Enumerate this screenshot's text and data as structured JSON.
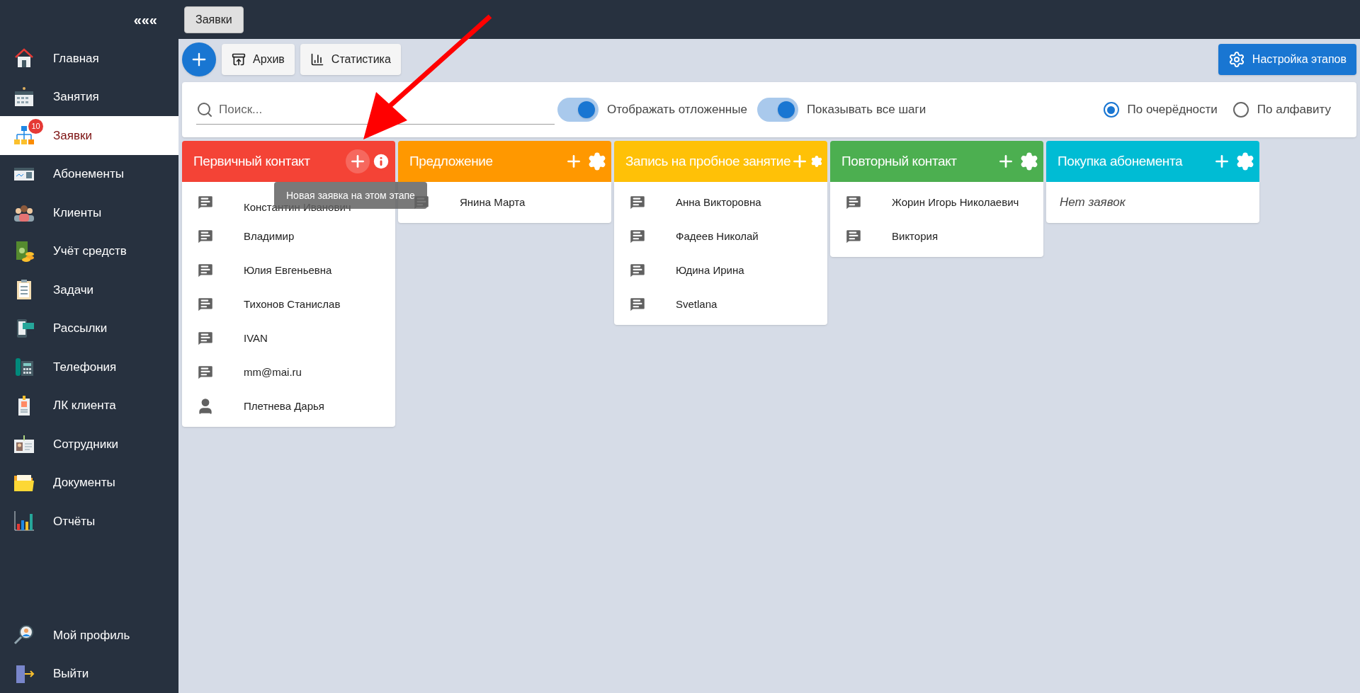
{
  "sidebar": {
    "collapse": "«««",
    "items": [
      {
        "label": "Главная",
        "selected": false
      },
      {
        "label": "Занятия",
        "selected": false
      },
      {
        "label": "Заявки",
        "selected": true,
        "badge": "10"
      },
      {
        "label": "Абонементы",
        "selected": false
      },
      {
        "label": "Клиенты",
        "selected": false
      },
      {
        "label": "Учёт средств",
        "selected": false
      },
      {
        "label": "Задачи",
        "selected": false
      },
      {
        "label": "Рассылки",
        "selected": false
      },
      {
        "label": "Телефония",
        "selected": false
      },
      {
        "label": "ЛК клиента",
        "selected": false
      },
      {
        "label": "Сотрудники",
        "selected": false
      },
      {
        "label": "Документы",
        "selected": false
      },
      {
        "label": "Отчёты",
        "selected": false
      }
    ],
    "bottom_items": [
      {
        "label": "Мой профиль"
      },
      {
        "label": "Выйти"
      }
    ]
  },
  "top_tab": "Заявки",
  "toolbar": {
    "archive": "Архив",
    "stats": "Статистика",
    "settings": "Настройка этапов"
  },
  "filters": {
    "search": {
      "placeholder": "Поиск..."
    },
    "toggles": [
      {
        "label": "Отображать отложенные",
        "on": true
      },
      {
        "label": "Показывать все шаги",
        "on": true
      }
    ],
    "sort": [
      {
        "label": "По очерёдности",
        "selected": true
      },
      {
        "label": "По алфавиту",
        "selected": false
      }
    ]
  },
  "columns": [
    {
      "title": "Первичный контакт",
      "color": "#f44336",
      "kind": "info",
      "add_hovered": true,
      "tooltip": "Новая заявка на этом этапе",
      "items": [
        {
          "name": "Константин Иванович",
          "kind": "message"
        },
        {
          "name": "Владимир",
          "kind": "message"
        },
        {
          "name": "Юлия Евгеньевна",
          "kind": "message"
        },
        {
          "name": "Тихонов Станислав",
          "kind": "message"
        },
        {
          "name": "IVAN",
          "kind": "message"
        },
        {
          "name": "mm@mai.ru",
          "kind": "message"
        },
        {
          "name": "Плетнева Дарья",
          "kind": "person"
        }
      ]
    },
    {
      "title": "Предложение",
      "color": "#ff9800",
      "kind": "settings",
      "add_hovered": false,
      "items": [
        {
          "name": "Янина Марта",
          "kind": "message"
        }
      ]
    },
    {
      "title": "Запись на пробное занятие",
      "color": "#ffc107",
      "kind": "settings",
      "add_hovered": false,
      "items": [
        {
          "name": "Анна Викторовна",
          "kind": "message"
        },
        {
          "name": "Фадеев Николай",
          "kind": "message"
        },
        {
          "name": "Юдина Ирина",
          "kind": "message"
        },
        {
          "name": "Svetlana",
          "kind": "message"
        }
      ]
    },
    {
      "title": "Повторный контакт",
      "color": "#4caf50",
      "kind": "settings",
      "add_hovered": false,
      "items": [
        {
          "name": "Жорин Игорь Николаевич",
          "kind": "message"
        },
        {
          "name": "Виктория",
          "kind": "message"
        }
      ]
    },
    {
      "title": "Покупка абонемента",
      "color": "#00bcd4",
      "kind": "settings",
      "add_hovered": false,
      "empty_text": "Нет заявок"
    }
  ]
}
